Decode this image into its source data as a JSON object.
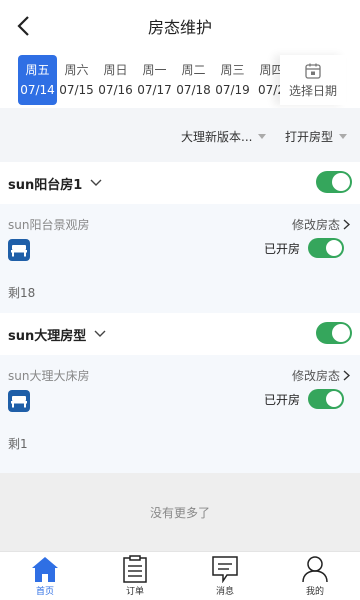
{
  "header": {
    "title": "房态维护"
  },
  "dates": [
    {
      "weekday": "周五",
      "date": "07/14",
      "active": true
    },
    {
      "weekday": "周六",
      "date": "07/15"
    },
    {
      "weekday": "周日",
      "date": "07/16"
    },
    {
      "weekday": "周一",
      "date": "07/17"
    },
    {
      "weekday": "周二",
      "date": "07/18"
    },
    {
      "weekday": "周三",
      "date": "07/19"
    },
    {
      "weekday": "周四",
      "date": "07/2"
    }
  ],
  "date_picker": {
    "label": "选择日期",
    "icon": "calendar-icon"
  },
  "filters": {
    "hotel": "大理新版本...",
    "room_type": "打开房型"
  },
  "groups": [
    {
      "name": "sun阳台房1",
      "toggle_on": true,
      "room": "sun阳台景观房",
      "edit_label": "修改房态",
      "status_label": "已开房",
      "remaining": "剩18"
    },
    {
      "name": "sun大理房型",
      "toggle_on": true,
      "room": "sun大理大床房",
      "edit_label": "修改房态",
      "status_label": "已开房",
      "remaining": "剩1"
    }
  ],
  "no_more": "没有更多了",
  "tabbar": [
    {
      "label": "首页",
      "icon": "home-icon",
      "active": true
    },
    {
      "label": "订单",
      "icon": "clipboard-icon"
    },
    {
      "label": "消息",
      "icon": "message-icon"
    },
    {
      "label": "我的",
      "icon": "user-icon"
    }
  ],
  "colors": {
    "accent": "#2f6fe4",
    "toggle_on": "#35a65c",
    "icon_blue": "#1f5fa8"
  }
}
